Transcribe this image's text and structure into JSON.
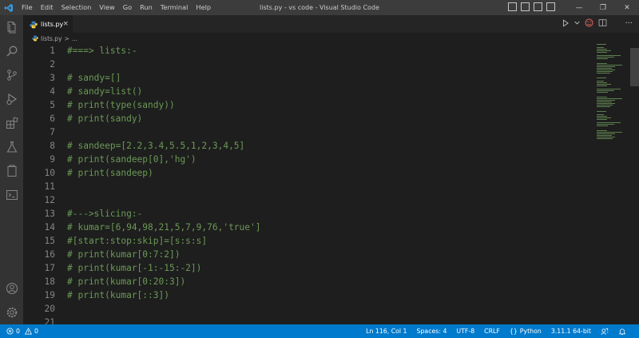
{
  "titlebar": {
    "menu": [
      "File",
      "Edit",
      "Selection",
      "View",
      "Go",
      "Run",
      "Terminal",
      "Help"
    ],
    "title": "lists.py - vs code - Visual Studio Code",
    "accent": "#3c3c3c"
  },
  "tab": {
    "label": "lists.py",
    "close": "×"
  },
  "breadcrumb": {
    "file": "lists.py",
    "sep": ">",
    "more": "..."
  },
  "editor": {
    "comment_color": "#6a9955",
    "lines": [
      {
        "n": "1",
        "text": "#===> lists:-"
      },
      {
        "n": "2",
        "text": ""
      },
      {
        "n": "3",
        "text": "# sandy=[]"
      },
      {
        "n": "4",
        "text": "# sandy=list()"
      },
      {
        "n": "5",
        "text": "# print(type(sandy))"
      },
      {
        "n": "6",
        "text": "# print(sandy)"
      },
      {
        "n": "7",
        "text": ""
      },
      {
        "n": "8",
        "text": "# sandeep=[2.2,3.4,5.5,1,2,3,4,5]"
      },
      {
        "n": "9",
        "text": "# print(sandeep[0],'hg')"
      },
      {
        "n": "10",
        "text": "# print(sandeep)"
      },
      {
        "n": "11",
        "text": ""
      },
      {
        "n": "12",
        "text": ""
      },
      {
        "n": "13",
        "text": "#--->slicing:-"
      },
      {
        "n": "14",
        "text": "# kumar=[6,94,98,21,5,7,9,76,'true']"
      },
      {
        "n": "15",
        "text": "#[start:stop:skip]=[s:s:s]"
      },
      {
        "n": "16",
        "text": "# print(kumar[0:7:2])"
      },
      {
        "n": "17",
        "text": "# print(kumar[-1:-15:-2])"
      },
      {
        "n": "18",
        "text": "# print(kumar[0:20:3])"
      },
      {
        "n": "19",
        "text": "# print(kumar[::3])"
      },
      {
        "n": "20",
        "text": ""
      },
      {
        "n": "21",
        "text": ""
      }
    ]
  },
  "statusbar": {
    "errors": "0",
    "warnings": "0",
    "position": "Ln 116, Col 1",
    "spaces": "Spaces: 4",
    "encoding": "UTF-8",
    "eol": "CRLF",
    "language": "Python",
    "interpreter": "3.11.1 64-bit",
    "color": "#007acc"
  }
}
